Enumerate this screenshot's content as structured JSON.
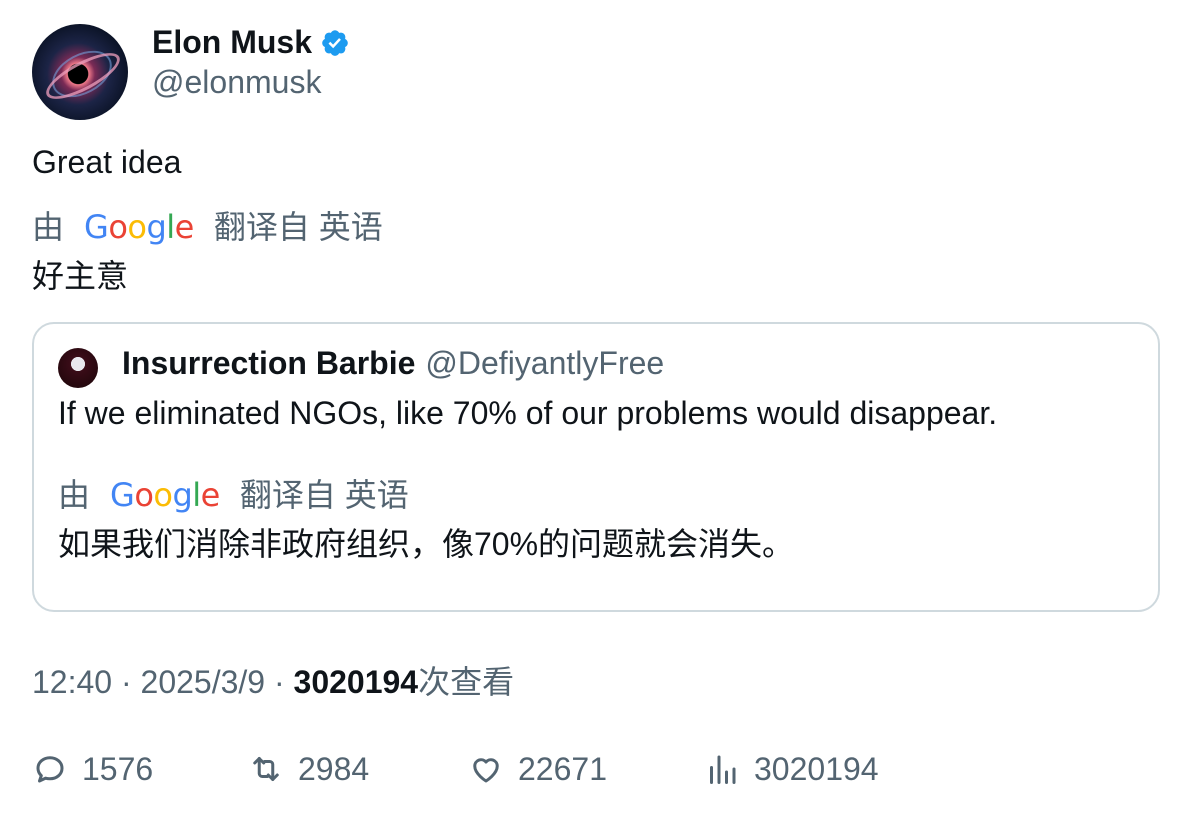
{
  "author": {
    "name": "Elon Musk",
    "handle": "@elonmusk"
  },
  "tweet": {
    "text": "Great idea",
    "translation_prefix": "由",
    "translation_suffix": "翻译自 英语",
    "translated_text": "好主意"
  },
  "quote": {
    "name": "Insurrection Barbie",
    "handle": "@DefiyantlyFree",
    "text": "If we eliminated NGOs, like 70% of our problems would disappear.",
    "translation_prefix": "由",
    "translation_suffix": "翻译自 英语",
    "translated_text": "如果我们消除非政府组织，像70%的问题就会消失。"
  },
  "meta": {
    "time_date": "12:40 · 2025/3/9 · ",
    "views": "3020194",
    "views_label": "次查看"
  },
  "actions": {
    "replies": "1576",
    "reposts": "2984",
    "likes": "22671",
    "views": "3020194"
  },
  "colors": {
    "secondary_text": "#536471",
    "verified": "#1d9bf0",
    "border": "#cfd9de"
  },
  "icons": [
    "verified-badge-icon",
    "google-logo",
    "reply-icon",
    "repost-icon",
    "like-icon",
    "views-icon"
  ]
}
